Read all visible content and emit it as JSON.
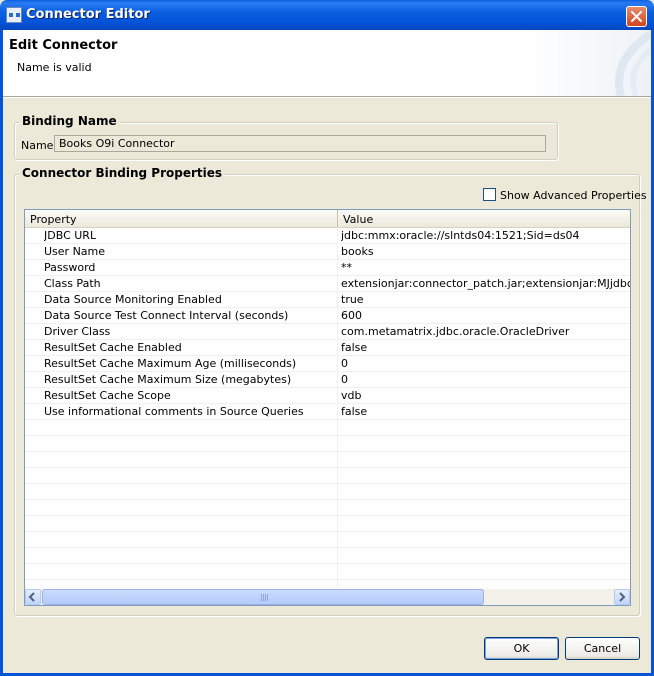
{
  "window": {
    "title": "Connector Editor"
  },
  "header": {
    "title": "Edit Connector",
    "message": "Name is valid"
  },
  "binding": {
    "group_label": "Binding Name",
    "name_label": "Name",
    "name_value": "Books O9i Connector"
  },
  "properties": {
    "group_label": "Connector Binding Properties",
    "show_advanced_label": "Show Advanced Properties",
    "show_advanced_checked": false,
    "columns": [
      "Property",
      "Value"
    ],
    "rows": [
      {
        "property": "JDBC URL",
        "value": "jdbc:mmx:oracle://slntds04:1521;Sid=ds04"
      },
      {
        "property": "User Name",
        "value": "books"
      },
      {
        "property": "Password",
        "value": "**"
      },
      {
        "property": "Class Path",
        "value": "extensionjar:connector_patch.jar;extensionjar:MJjdbc.jar;e"
      },
      {
        "property": "Data Source Monitoring Enabled",
        "value": "true"
      },
      {
        "property": "Data Source Test Connect Interval (seconds)",
        "value": "600"
      },
      {
        "property": "Driver Class",
        "value": "com.metamatrix.jdbc.oracle.OracleDriver"
      },
      {
        "property": "ResultSet Cache Enabled",
        "value": "false"
      },
      {
        "property": "ResultSet Cache Maximum Age (milliseconds)",
        "value": "0"
      },
      {
        "property": "ResultSet Cache Maximum Size (megabytes)",
        "value": "0"
      },
      {
        "property": "ResultSet Cache Scope",
        "value": "vdb"
      },
      {
        "property": "Use informational comments in Source Queries",
        "value": "false"
      }
    ]
  },
  "buttons": {
    "ok": "OK",
    "cancel": "Cancel"
  },
  "icons": {
    "window": "connector-icon",
    "close": "close-icon",
    "left": "arrow-left-icon",
    "right": "arrow-right-icon"
  },
  "colors": {
    "titlebar": "#0553d6",
    "close": "#d2451f",
    "face": "#ece9d8"
  }
}
